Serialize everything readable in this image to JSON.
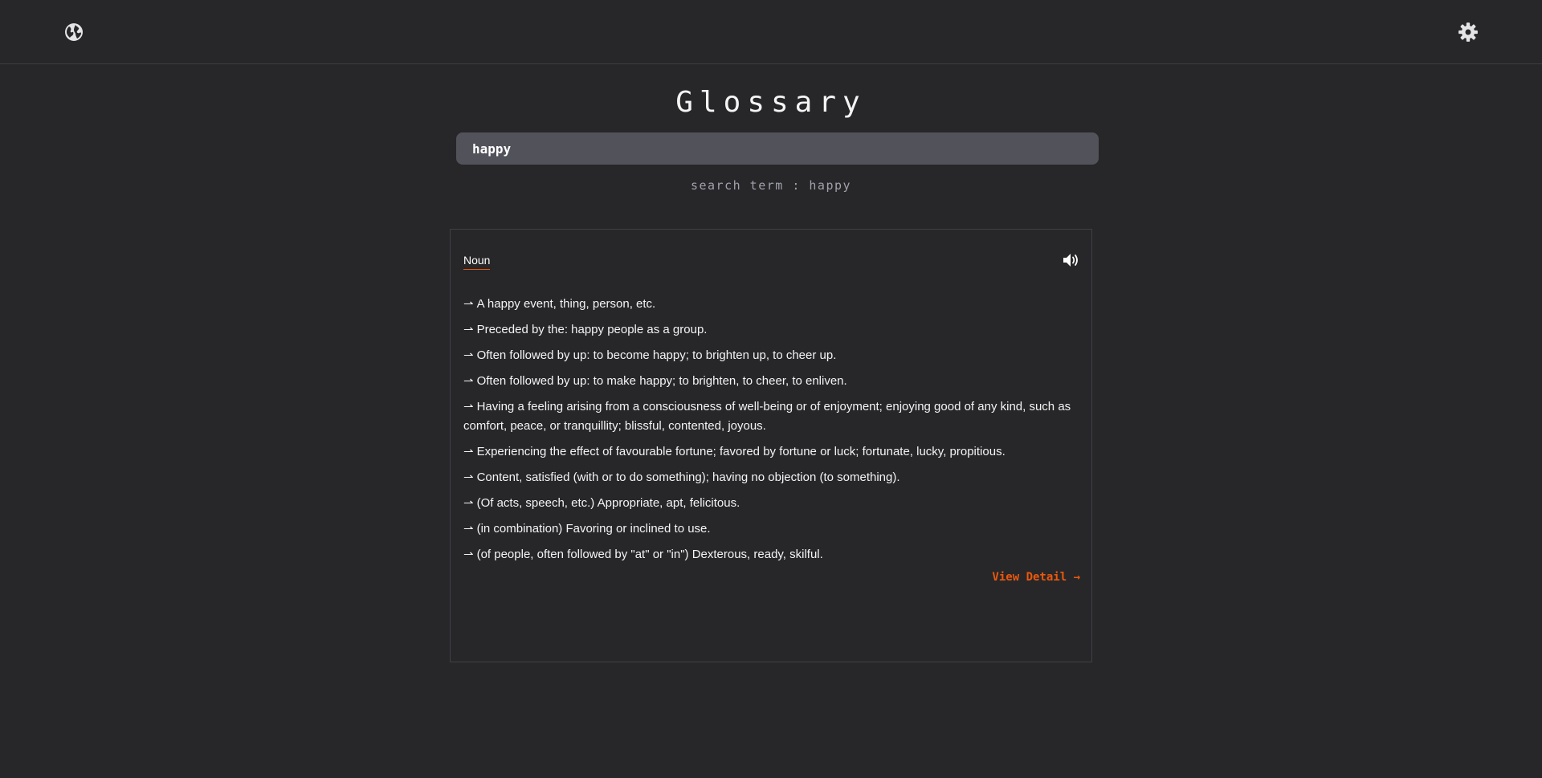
{
  "header": {
    "left_icon": "globe-icon",
    "right_icon": "gear-icon"
  },
  "title": "Glossary",
  "search": {
    "value": "happy",
    "term_display": "search term : happy"
  },
  "result": {
    "part_of_speech": "Noun",
    "audio_icon": "speaker-icon",
    "arrow_glyph": "⇀",
    "definitions": [
      "A happy event, thing, person, etc.",
      "Preceded by the: happy people as a group.",
      "Often followed by up: to become happy; to brighten up, to cheer up.",
      "Often followed by up: to make happy; to brighten, to cheer, to enliven.",
      "Having a feeling arising from a consciousness of well-being or of enjoyment; enjoying good of any kind, such as comfort, peace, or tranquillity; blissful, contented, joyous.",
      "Experiencing the effect of favourable fortune; favored by fortune or luck; fortunate, lucky, propitious.",
      "Content, satisfied (with or to do something); having no objection (to something).",
      "(Of acts, speech, etc.) Appropriate, apt, felicitous.",
      "(in combination) Favoring or inclined to use.",
      "(of people, often followed by \"at\" or \"in\") Dexterous, ready, skilful."
    ],
    "view_detail_label": "View Detail →"
  },
  "colors": {
    "background": "#27272a",
    "input_bg": "#52525b",
    "accent": "#ea580c",
    "muted_text": "#a1a1aa"
  }
}
